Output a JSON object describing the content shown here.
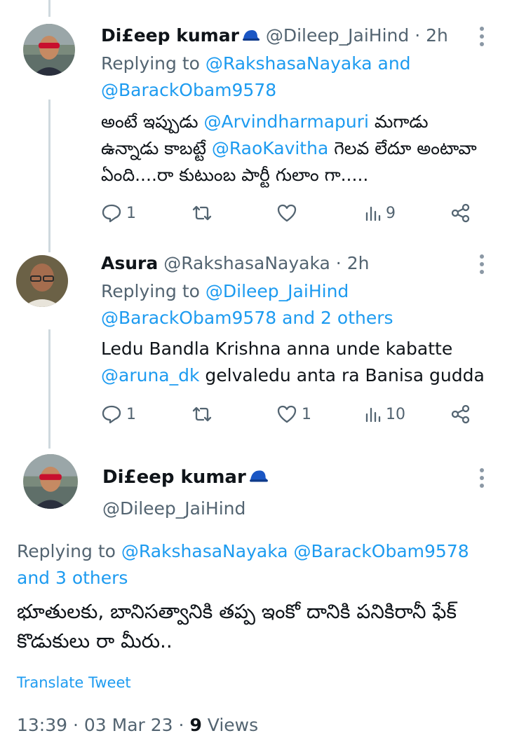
{
  "tweets": [
    {
      "name": "Di£eep kumar",
      "handle": "@Dileep_JaiHind",
      "sep": "·",
      "time": "2h",
      "replying_prefix": "Replying to",
      "reply_to_1": "@RakshasaNayaka",
      "reply_and": "and",
      "reply_to_2": "@BarackObam9578",
      "text_1": "అంటే ఇప్పుడు",
      "mention_1": "@Arvindharmapuri",
      "text_2": "మగాడు ఉన్నాడు కాబట్టే",
      "mention_2": "@RaoKavitha",
      "text_3": "గెలవ లేదూ అంటావా ఏంది....రా కుటుంబ పార్టీ గులాం గా.....",
      "replies": "1",
      "retweets": "",
      "likes": "",
      "views": "9"
    },
    {
      "name": "Asura",
      "handle": "@RakshasaNayaka",
      "sep": "·",
      "time": "2h",
      "replying_prefix": "Replying to",
      "reply_to_1": "@Dileep_JaiHind",
      "reply_line2": "@BarackObam9578 and 2 others",
      "text_1": "Ledu Bandla Krishna anna unde kabatte",
      "mention_1": "@aruna_dk",
      "text_2": "gelvaledu anta ra Banisa gudda",
      "replies": "1",
      "retweets": "",
      "likes": "1",
      "views": "10"
    }
  ],
  "main_tweet": {
    "name": "Di£eep kumar",
    "handle": "@Dileep_JaiHind",
    "replying_prefix": "Replying to",
    "reply_links": "@RakshasaNayaka @BarackObam9578",
    "reply_others": "and 3 others",
    "text": "భూతులకు, బానిసత్వానికి తప్ప ఇంకో దానికి పనికిరానీ ఫేక్ కొడుకులు రా మీరు..",
    "translate": "Translate Tweet",
    "timestamp": "13:39 · 03 Mar 23",
    "views_sep": "·",
    "views_count": "9",
    "views_label": "Views"
  },
  "icons": {
    "reply": "reply-icon",
    "retweet": "retweet-icon",
    "like": "heart-icon",
    "views": "views-icon",
    "share": "share-icon",
    "more": "more-icon",
    "cap": "blue-cap-emoji"
  },
  "colors": {
    "link": "#1d9bf0",
    "muted": "#536471",
    "text": "#0f1419",
    "line": "#cfd9de"
  }
}
